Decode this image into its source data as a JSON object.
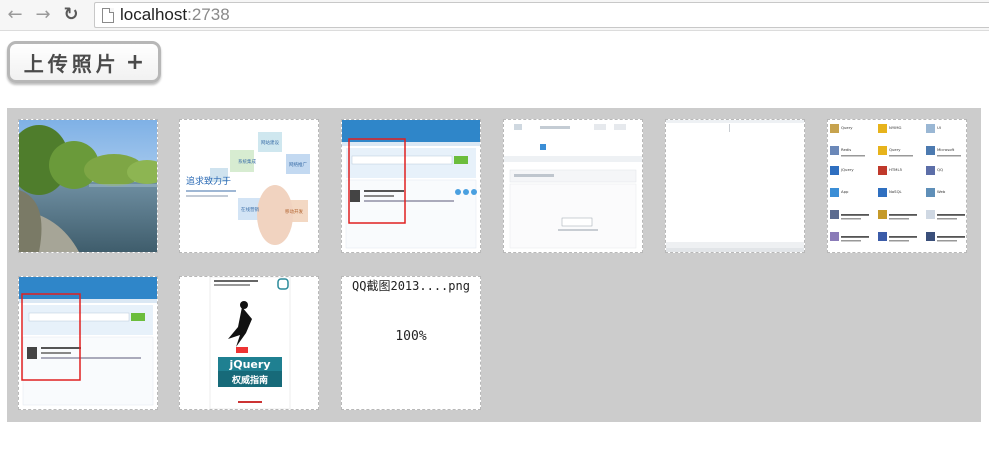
{
  "browser": {
    "url_host": "localhost",
    "url_port": ":2738",
    "icons": {
      "back": "arrow-left-icon",
      "forward": "arrow-right-icon",
      "reload": "reload-icon",
      "page": "page-icon"
    }
  },
  "upload": {
    "label": "上传照片",
    "plus": "+"
  },
  "thumb2": {
    "headline": "追求致力于",
    "tiles": [
      "系统集成",
      "网站建设",
      "网络推广",
      "在线营销",
      "移动开发"
    ]
  },
  "thumb6": {
    "files": [
      "Query",
      "NYIMG",
      "UI",
      "Redis",
      "Query",
      "Microsoft",
      "jQuery",
      "HTML5",
      "QQ",
      "App",
      "NoSQL",
      "Web"
    ]
  },
  "thumb8": {
    "brand_big": "jQuery",
    "brand_sub": "权威指南"
  },
  "uploading": {
    "filename": "QQ截图2013....png",
    "progress": "100%"
  },
  "colors": {
    "gallery_bg": "#cccccc",
    "highlight_red": "#e02020",
    "ui_blue": "#2f86c9"
  }
}
